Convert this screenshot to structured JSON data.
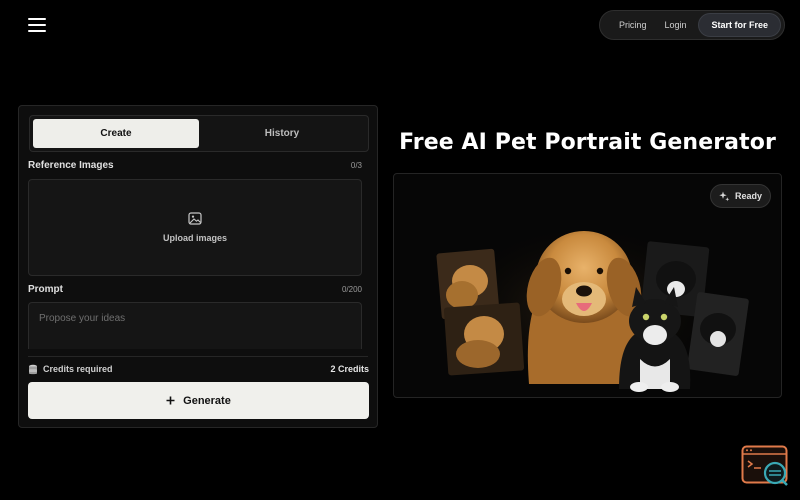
{
  "header": {
    "nav": {
      "pricing": "Pricing",
      "login": "Login",
      "cta": "Start for Free"
    }
  },
  "panel": {
    "tabs": [
      {
        "label": "Create",
        "active": true
      },
      {
        "label": "History",
        "active": false
      }
    ],
    "reference": {
      "label": "Reference Images",
      "counter": "0/3",
      "upload_label": "Upload images"
    },
    "prompt": {
      "label": "Prompt",
      "counter": "0/200",
      "placeholder": "Propose your ideas",
      "value": ""
    },
    "credits": {
      "label": "Credits required",
      "value": "2 Credits"
    },
    "generate_label": "Generate"
  },
  "hero": {
    "title": "Free AI Pet Portrait Generator",
    "status": "Ready"
  },
  "colors": {
    "background": "#000000",
    "panel": "#0e0e0e",
    "button_light": "#f0f0ec",
    "helper_accent": "#e07a4a",
    "helper_teal": "#3aa9b5"
  },
  "icons": [
    "menu-icon",
    "image-icon",
    "coin-stack-icon",
    "plus-icon",
    "sparkle-icon",
    "help-widget-icon"
  ]
}
